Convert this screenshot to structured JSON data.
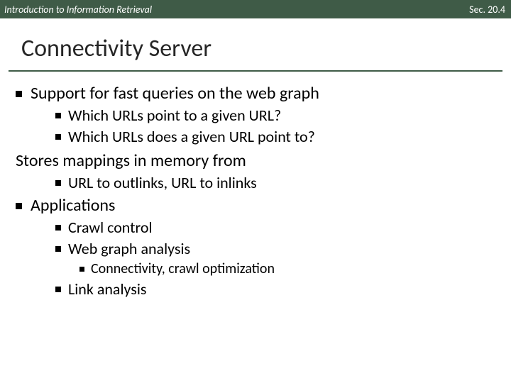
{
  "header": {
    "left": "Introduction to Information Retrieval",
    "right": "Sec. 20.4"
  },
  "title": "Connectivity Server",
  "items": {
    "l1a": "Support for fast queries on the web graph",
    "l2a": "Which URLs point to a given URL?",
    "l2b": "Which URLs does a given URL point to?",
    "l1b": "Stores mappings in memory from",
    "l2c": "URL to outlinks, URL to inlinks",
    "l1c": "Applications",
    "l2d": "Crawl control",
    "l2e": "Web graph analysis",
    "l3a": "Connectivity, crawl optimization",
    "l2f": "Link analysis"
  }
}
